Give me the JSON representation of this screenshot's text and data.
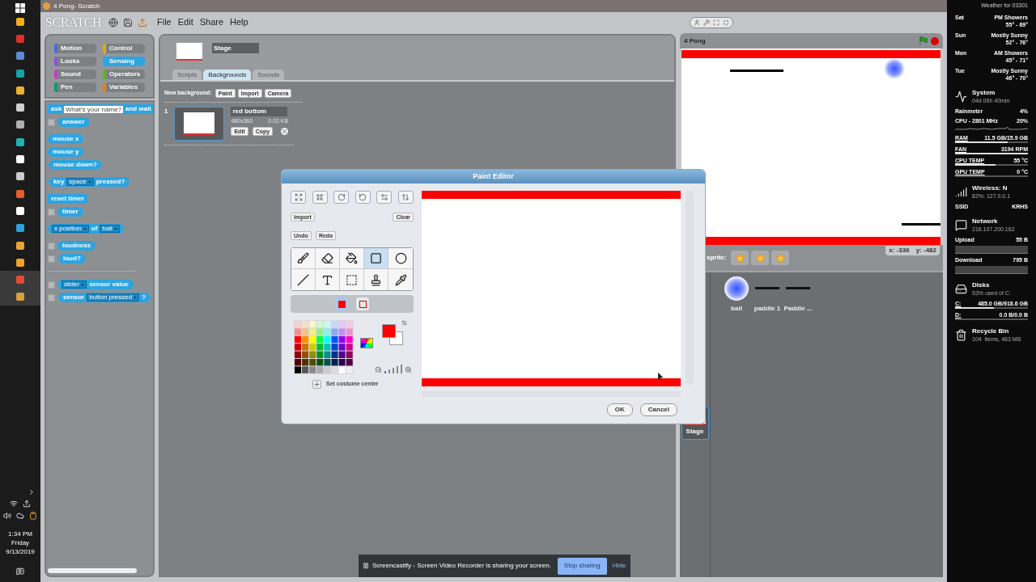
{
  "taskbar": {
    "time": "1:34 PM",
    "day": "Friday",
    "date": "9/13/2019"
  },
  "window": {
    "title": "4 Pong- Scratch"
  },
  "logo": "SCRATCH",
  "menu": [
    "File",
    "Edit",
    "Share",
    "Help"
  ],
  "categories": [
    {
      "label": "Motion",
      "color": "#4a6cd4",
      "selected": false
    },
    {
      "label": "Control",
      "color": "#e1a91a",
      "selected": false
    },
    {
      "label": "Looks",
      "color": "#8a55d7",
      "selected": false
    },
    {
      "label": "Sensing",
      "color": "#2ca5e2",
      "selected": true
    },
    {
      "label": "Sound",
      "color": "#bb42c3",
      "selected": false
    },
    {
      "label": "Operators",
      "color": "#5cb712",
      "selected": false
    },
    {
      "label": "Pen",
      "color": "#0e9a6c",
      "selected": false
    },
    {
      "label": "Variables",
      "color": "#ee7d16",
      "selected": false
    }
  ],
  "block_groups": [
    {
      "separated": false,
      "blocks": [
        {
          "kind": "command",
          "parts": [
            {
              "kind": "text",
              "text": "ask"
            },
            {
              "kind": "input",
              "text": "What's your name?"
            },
            {
              "kind": "text",
              "text": "and wait"
            }
          ]
        },
        {
          "kind": "reporter",
          "checked": false,
          "parts": [
            {
              "kind": "text",
              "text": "answer"
            }
          ]
        }
      ]
    },
    {
      "separated": false,
      "blocks": [
        {
          "kind": "reporter",
          "parts": [
            {
              "kind": "text",
              "text": "mouse x"
            }
          ]
        },
        {
          "kind": "reporter",
          "parts": [
            {
              "kind": "text",
              "text": "mouse y"
            }
          ]
        },
        {
          "kind": "boolean",
          "parts": [
            {
              "kind": "text",
              "text": "mouse down?"
            }
          ]
        }
      ]
    },
    {
      "separated": false,
      "blocks": [
        {
          "kind": "boolean",
          "parts": [
            {
              "kind": "text",
              "text": "key"
            },
            {
              "kind": "dropdown",
              "text": "space"
            },
            {
              "kind": "text",
              "text": "pressed?"
            }
          ]
        }
      ]
    },
    {
      "separated": false,
      "blocks": [
        {
          "kind": "command",
          "parts": [
            {
              "kind": "text",
              "text": "reset timer"
            }
          ]
        },
        {
          "kind": "reporter",
          "checked": false,
          "parts": [
            {
              "kind": "text",
              "text": "timer"
            }
          ]
        }
      ]
    },
    {
      "separated": false,
      "blocks": [
        {
          "kind": "reporter",
          "parts": [
            {
              "kind": "dropdown",
              "text": "x position"
            },
            {
              "kind": "text",
              "text": "of"
            },
            {
              "kind": "dropdown",
              "text": "ball"
            }
          ]
        }
      ]
    },
    {
      "separated": false,
      "blocks": [
        {
          "kind": "reporter",
          "checked": false,
          "parts": [
            {
              "kind": "text",
              "text": "loudness"
            }
          ]
        },
        {
          "kind": "boolean",
          "checked": false,
          "parts": [
            {
              "kind": "text",
              "text": "loud?"
            }
          ]
        }
      ]
    },
    {
      "separated": true,
      "blocks": [
        {
          "kind": "reporter",
          "checked": false,
          "parts": [
            {
              "kind": "dropdown",
              "text": "slider"
            },
            {
              "kind": "text",
              "text": "sensor value"
            }
          ]
        },
        {
          "kind": "boolean",
          "checked": false,
          "parts": [
            {
              "kind": "text",
              "text": "sensor"
            },
            {
              "kind": "dropdown",
              "text": "button pressed"
            },
            {
              "kind": "text",
              "text": "?"
            }
          ]
        }
      ]
    }
  ],
  "sprite_info": {
    "name": "Stage"
  },
  "tabs": [
    {
      "label": "Scripts",
      "selected": false
    },
    {
      "label": "Backgrounds",
      "selected": true
    },
    {
      "label": "Sounds",
      "selected": false
    }
  ],
  "new_background": {
    "label": "New background:",
    "buttons": [
      "Paint",
      "Import",
      "Camera"
    ]
  },
  "costumes": [
    {
      "number": "1",
      "name": "red bottom",
      "size": "480x360",
      "file_size": "0.02 KB",
      "buttons": [
        "Edit",
        "Copy"
      ],
      "selected": true
    }
  ],
  "stage": {
    "title": "4 Pong",
    "x": "x: -336",
    "y": "y: -482"
  },
  "sprite_toolbar": {
    "label": "sprite:"
  },
  "sprites": [
    {
      "name": "ball",
      "kind": "ball"
    },
    {
      "name": "paddle 1",
      "kind": "paddle"
    },
    {
      "name": "Paddle ...",
      "kind": "paddle"
    }
  ],
  "stage_thumb": {
    "label": "Stage",
    "selected": true
  },
  "paint_editor": {
    "title": "Paint Editor",
    "import": "Import",
    "clear": "Clear",
    "history": [
      "Undo",
      "Redo"
    ],
    "tools": [
      {
        "kind": "brush",
        "selected": false
      },
      {
        "kind": "eraser",
        "selected": false
      },
      {
        "kind": "fill",
        "selected": false
      },
      {
        "kind": "rectangle",
        "selected": true
      },
      {
        "kind": "ellipse",
        "selected": false
      },
      {
        "kind": "line",
        "selected": false
      },
      {
        "kind": "text",
        "selected": false
      },
      {
        "kind": "select",
        "selected": false
      },
      {
        "kind": "stamp",
        "selected": false
      },
      {
        "kind": "eyedropper",
        "selected": false
      }
    ],
    "fill_modes": [
      {
        "kind": "filled",
        "selected": true
      },
      {
        "kind": "outline",
        "selected": false
      }
    ],
    "foreground": {
      "color": "#ff0000"
    },
    "background": {
      "color": "#ffffff"
    },
    "zoom": {
      "level": 0.2
    },
    "center_label": "Set costume center",
    "actions": [
      "OK",
      "Cancel"
    ]
  },
  "weather": {
    "title": "Weather for 03301",
    "days": [
      {
        "day": "Sat",
        "forecast": "PM Showers",
        "range": "55° - 69°"
      },
      {
        "day": "Sun",
        "forecast": "Mostly Sunny",
        "range": "52° - 76°"
      },
      {
        "day": "Mon",
        "forecast": "AM Showers",
        "range": "45° - 71°"
      },
      {
        "day": "Tue",
        "forecast": "Mostly Sunny",
        "range": "46° - 70°"
      }
    ]
  },
  "system": {
    "title": "System",
    "detail": "04d 06h 40min",
    "rows": [
      {
        "kind": "plain",
        "label": "Rainmeter",
        "value": "4%"
      },
      {
        "kind": "graph",
        "label": "CPU - 2801 MHz",
        "value": "20%"
      },
      {
        "kind": "bar",
        "label": "RAM",
        "value": "11.5 GB/15.9 GB",
        "level": 0.72
      },
      {
        "kind": "bar",
        "label": "FAN",
        "value": "3194 RPM",
        "level": 1
      },
      {
        "kind": "bar",
        "label": "CPU TEMP",
        "value": "55 °C",
        "level": 0.55
      },
      {
        "kind": "bar",
        "label": "GPU TEMP",
        "value": "0 °C",
        "level": 0
      }
    ]
  },
  "wireless": {
    "title": "Wireless: N",
    "detail": "82%: 127.0.0.1",
    "rows": [
      {
        "kind": "plain",
        "label": "SSID",
        "value": "KRHS"
      }
    ]
  },
  "network": {
    "title": "Network",
    "detail": "216.107.200.162",
    "rows": [
      {
        "kind": "box",
        "label": "Upload",
        "value": "55 B"
      },
      {
        "kind": "box",
        "label": "Download",
        "value": "795 B"
      }
    ]
  },
  "disks": {
    "title": "Disks",
    "detail": "53% used of C:",
    "rows": [
      {
        "kind": "bar",
        "label": "C:",
        "value": "485.0 GB/918.6 GB",
        "level": 0.53
      },
      {
        "kind": "bar",
        "label": "D:",
        "value": "0.0 B/0.0 B",
        "level": 0
      }
    ]
  },
  "recycle_bin": {
    "title": "Recycle Bin",
    "detail": "104  items, 463 MB"
  },
  "share_bar": {
    "message": "Screencastify - Screen Video Recorder is sharing your screen.",
    "stop": "Stop sharing",
    "hide": "Hide"
  }
}
